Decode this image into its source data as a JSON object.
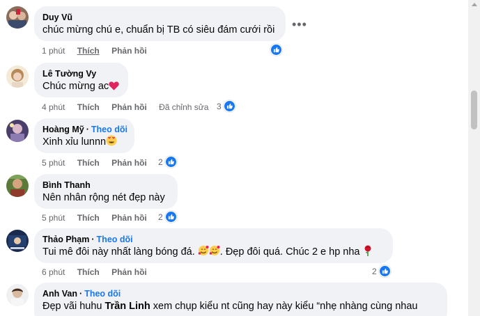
{
  "comments": [
    {
      "author": "Duy Vũ",
      "follow": "",
      "text": "chúc mừng chú e, chuẩn bị TB có siêu đám cưới rồi",
      "time": "1 phút",
      "like": "Thích",
      "reply": "Phản hồi",
      "edited": "",
      "reaction_count": "",
      "more_icon": "more-options-icon"
    },
    {
      "author": "Lê Tường Vy",
      "follow": "",
      "text": "Chúc mừng ac",
      "emoji": "red-heart-icon",
      "time": "4 phút",
      "like": "Thích",
      "reply": "Phản hồi",
      "edited": "Đã chỉnh sửa",
      "reaction_count": "3"
    },
    {
      "author": "Hoàng Mỹ",
      "follow": "Theo dõi",
      "text": "Xinh xỉu lunnn",
      "emoji": "heart-eyes-icon",
      "time": "5 phút",
      "like": "Thích",
      "reply": "Phản hồi",
      "edited": "",
      "reaction_count": "2"
    },
    {
      "author": "Bình Thanh",
      "follow": "",
      "text": "Nên nhân rộng nét đẹp này",
      "time": "5 phút",
      "like": "Thích",
      "reply": "Phản hồi",
      "edited": "",
      "reaction_count": "2"
    },
    {
      "author": "Thảo Phạm",
      "follow": "Theo dõi",
      "text_a": "Tui mê đôi này nhất làng bóng đá.",
      "text_b": ". Đẹp đôi quá. Chúc 2 e hp nha",
      "emojis": [
        "smiling-hearts-icon",
        "smiling-hearts-icon",
        "rose-icon"
      ],
      "time": "6 phút",
      "like": "Thích",
      "reply": "Phản hồi",
      "edited": "",
      "reaction_count": "2"
    },
    {
      "author": "Anh Van",
      "follow": "Theo dõi",
      "text_a": "Đẹp vãi huhu",
      "mention": "Trần Linh",
      "text_b": "xem chụp kiểu nt cũng hay này kiểu “nhẹ nhàng cùng nhau"
    }
  ],
  "colors": {
    "bubble": "#f0f2f5",
    "accent": "#1877f2",
    "muted": "#65676b"
  }
}
